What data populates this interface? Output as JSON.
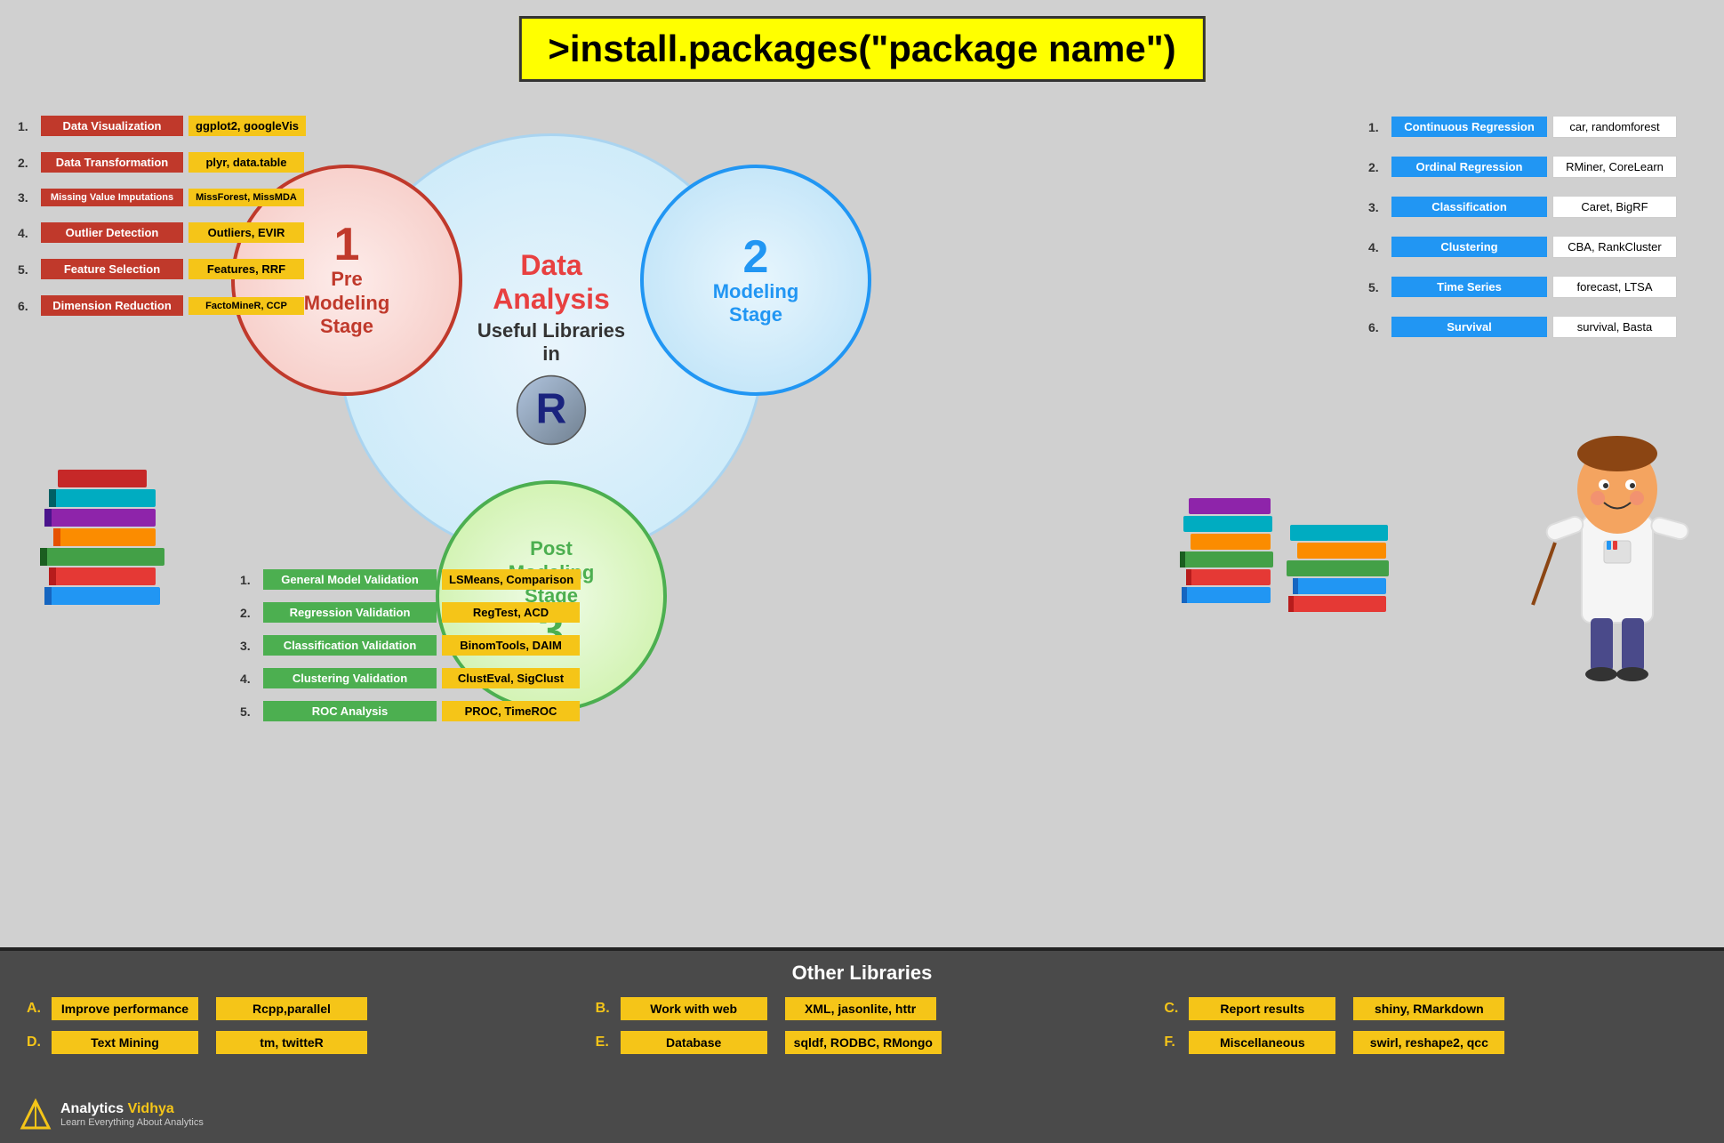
{
  "header": {
    "title": ">install.packages(\"package name\")"
  },
  "center": {
    "title1": "Data",
    "title2": "Analysis",
    "title3": "Useful Libraries",
    "title4": "in"
  },
  "pre_modeling": {
    "circle_num": "1",
    "circle_label": "Pre\nModeling\nStage",
    "items": [
      {
        "num": "1.",
        "label": "Data Visualization",
        "value": "ggplot2, googleVis"
      },
      {
        "num": "2.",
        "label": "Data Transformation",
        "value": "plyr, data.table"
      },
      {
        "num": "3.",
        "label": "Missing Value Imputations",
        "value": "MissForest, MissMDA"
      },
      {
        "num": "4.",
        "label": "Outlier Detection",
        "value": "Outliers, EVIR"
      },
      {
        "num": "5.",
        "label": "Feature Selection",
        "value": "Features, RRF"
      },
      {
        "num": "6.",
        "label": "Dimension Reduction",
        "value": "FactoMineR, CCP"
      }
    ]
  },
  "modeling": {
    "circle_num": "2",
    "circle_label": "Modeling\nStage",
    "items": [
      {
        "num": "1.",
        "label": "Continuous Regression",
        "value": "car, randomforest"
      },
      {
        "num": "2.",
        "label": "Ordinal Regression",
        "value": "RMiner, CoreLearn"
      },
      {
        "num": "3.",
        "label": "Classification",
        "value": "Caret, BigRF"
      },
      {
        "num": "4.",
        "label": "Clustering",
        "value": "CBA, RankCluster"
      },
      {
        "num": "5.",
        "label": "Time Series",
        "value": "forecast, LTSA"
      },
      {
        "num": "6.",
        "label": "Survival",
        "value": "survival, Basta"
      }
    ]
  },
  "post_modeling": {
    "circle_num": "3",
    "circle_label": "Post\nModeling\nStage",
    "items": [
      {
        "num": "1.",
        "label": "General Model Validation",
        "value": "LSMeans, Comparison"
      },
      {
        "num": "2.",
        "label": "Regression Validation",
        "value": "RegTest, ACD"
      },
      {
        "num": "3.",
        "label": "Classification Validation",
        "value": "BinomTools, DAIM"
      },
      {
        "num": "4.",
        "label": "Clustering Validation",
        "value": "ClustEval, SigClust"
      },
      {
        "num": "5.",
        "label": "ROC Analysis",
        "value": "PROC, TimeROC"
      }
    ]
  },
  "other_libraries": {
    "title": "Other Libraries",
    "items": [
      {
        "id": "A.",
        "label": "Improve performance",
        "value": "Rcpp,parallel"
      },
      {
        "id": "B.",
        "label": "Work with web",
        "value": "XML, jasonlite, httr"
      },
      {
        "id": "C.",
        "label": "Report results",
        "value": "shiny, RMarkdown"
      },
      {
        "id": "D.",
        "label": "Text Mining",
        "value": "tm, twitteR"
      },
      {
        "id": "E.",
        "label": "Database",
        "value": "sqldf, RODBC, RMongo"
      },
      {
        "id": "F.",
        "label": "Miscellaneous",
        "value": "swirl, reshape2, qcc"
      }
    ]
  },
  "logo": {
    "name": "Analytics Vidhya",
    "highlight": "Vidhya",
    "sub": "Learn Everything About Analytics"
  }
}
